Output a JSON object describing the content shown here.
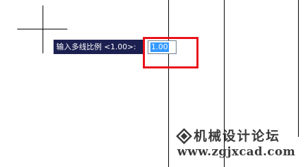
{
  "command_line": {
    "prompt_text": "输入多线比例 <1.00>:",
    "input_value": "1.00"
  },
  "watermark": {
    "title": "机械设计论坛",
    "url": "www.zgjxcad.com"
  },
  "colors": {
    "prompt_background": "#1c2050",
    "selection_highlight": "#3399ff",
    "annotation_box": "#e8101a"
  }
}
